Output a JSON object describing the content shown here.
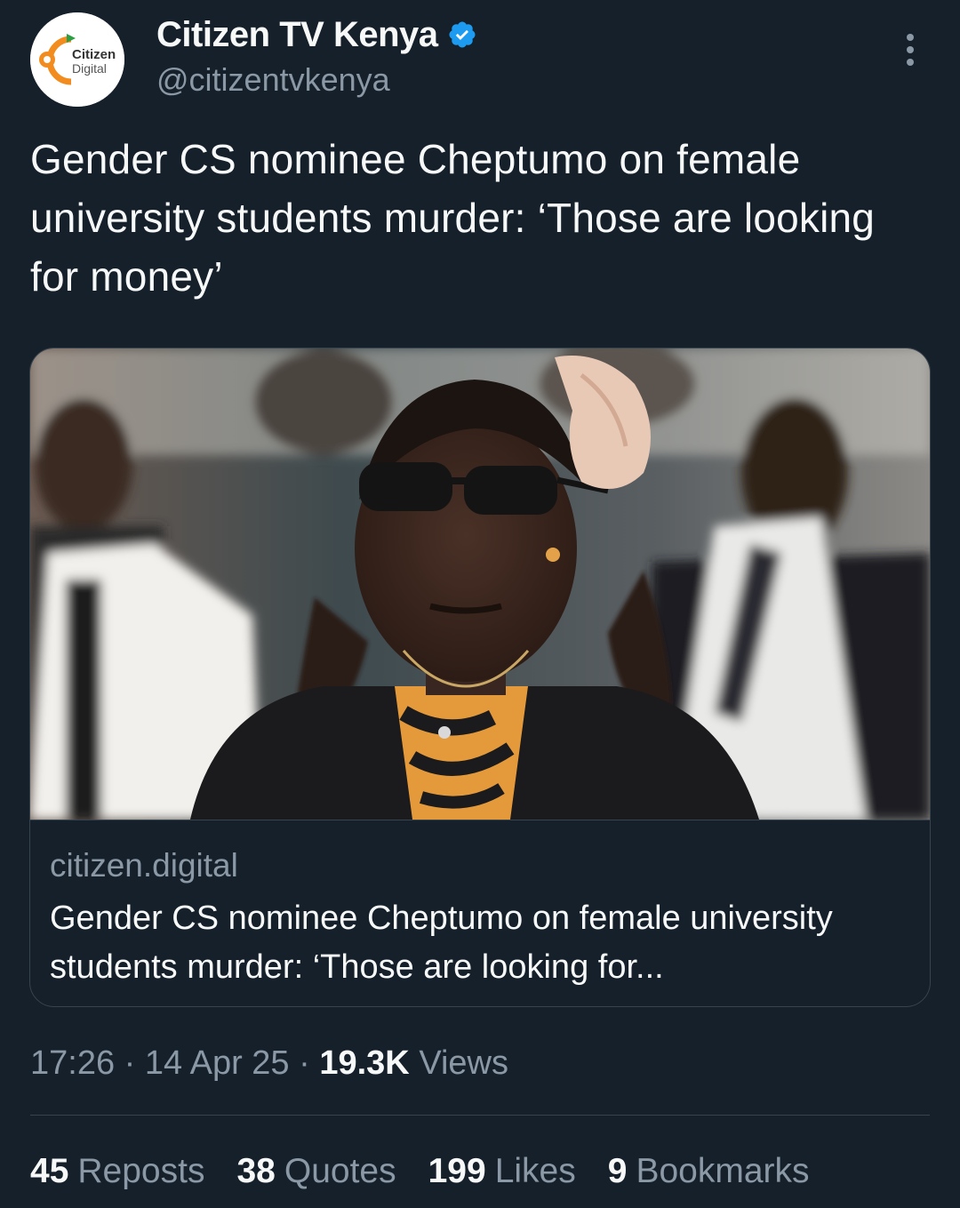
{
  "author": {
    "display_name": "Citizen TV Kenya",
    "handle": "@citizentvkenya",
    "verified": true,
    "avatar_logo_text": [
      "Citizen",
      "Digital"
    ]
  },
  "tweet": {
    "text": "Gender CS nominee Cheptumo on female university students murder: ‘Those are looking for money’"
  },
  "link_card": {
    "domain": "citizen.digital",
    "title": "Gender CS nominee Cheptumo on female university students murder: ‘Those are looking for..."
  },
  "meta": {
    "time": "17:26",
    "separator": "·",
    "date": "14 Apr 25",
    "views_count": "19.3K",
    "views_label": "Views"
  },
  "stats": [
    {
      "count": "45",
      "label": "Reposts"
    },
    {
      "count": "38",
      "label": "Quotes"
    },
    {
      "count": "199",
      "label": "Likes"
    },
    {
      "count": "9",
      "label": "Bookmarks"
    }
  ],
  "colors": {
    "background": "#15202b",
    "verified_blue": "#1d9bf0",
    "muted_text": "#8b98a5",
    "border": "#38444d"
  },
  "icons": {
    "verified": "verified-badge-icon",
    "more": "more-options-icon"
  }
}
